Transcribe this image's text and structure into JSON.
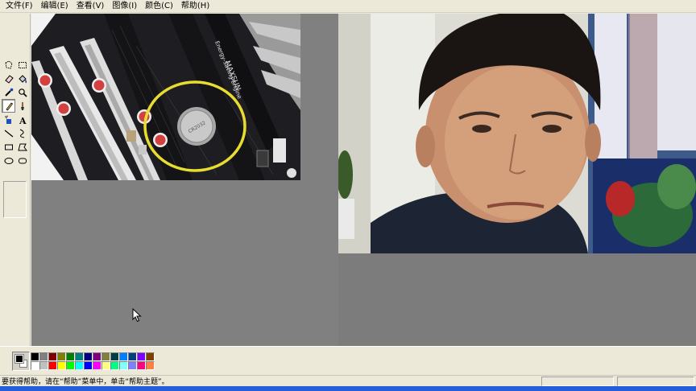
{
  "menu": [
    {
      "label": "文件(F)"
    },
    {
      "label": "编辑(E)"
    },
    {
      "label": "查看(V)"
    },
    {
      "label": "图像(I)"
    },
    {
      "label": "颜色(C)"
    },
    {
      "label": "帮助(H)"
    }
  ],
  "tools": [
    {
      "name": "free-form-select-icon"
    },
    {
      "name": "rect-select-icon"
    },
    {
      "name": "eraser-icon"
    },
    {
      "name": "fill-bucket-icon"
    },
    {
      "name": "color-picker-icon"
    },
    {
      "name": "magnifier-icon"
    },
    {
      "name": "pencil-icon",
      "active": true
    },
    {
      "name": "brush-icon"
    },
    {
      "name": "airbrush-icon"
    },
    {
      "name": "text-icon"
    },
    {
      "name": "line-icon"
    },
    {
      "name": "curve-icon"
    },
    {
      "name": "rectangle-icon"
    },
    {
      "name": "polygon-icon"
    },
    {
      "name": "ellipse-icon"
    },
    {
      "name": "rounded-rect-icon"
    }
  ],
  "drawing": {
    "board_text_1": "Energy-Saving Engine",
    "board_text_2": "MAXSUN",
    "highlight_color": "#e8dc30"
  },
  "palette": {
    "foreground": "#000000",
    "background": "#ffffff",
    "colors": [
      "#000000",
      "#808080",
      "#800000",
      "#808000",
      "#008000",
      "#008080",
      "#000080",
      "#800080",
      "#808040",
      "#004040",
      "#0080ff",
      "#004080",
      "#8000ff",
      "#804000",
      "#ffffff",
      "#c0c0c0",
      "#ff0000",
      "#ffff00",
      "#00ff00",
      "#00ffff",
      "#0000ff",
      "#ff00ff",
      "#ffff80",
      "#00ff80",
      "#80ffff",
      "#8080ff",
      "#ff0080",
      "#ff8040"
    ]
  },
  "status": {
    "help_text": "要获得帮助，请在“帮助”菜单中，单击“帮助主题”。"
  }
}
